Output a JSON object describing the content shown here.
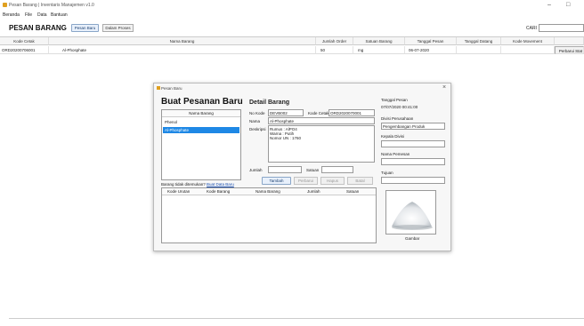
{
  "window": {
    "title": "Pesan Barang | Inventaris Manajemen v1.0",
    "min": "–",
    "max": "□"
  },
  "menu": [
    "Beranda",
    "File",
    "Data",
    "Bantuan"
  ],
  "page": {
    "title": "PESAN BARANG",
    "btn_pesan_baru": "Pesan Baru",
    "btn_dalam_proses": "Dalam Proses",
    "search_label": "CARI",
    "search_value": ""
  },
  "grid": {
    "columns": [
      "Kode Cetak",
      "Nama Barang",
      "Jumlah Order",
      "Satuan Barang",
      "Tanggal Pesan",
      "Tanggal Datang",
      "Kode Movement"
    ],
    "rows": [
      {
        "kode_cetak": "ORD20200706001",
        "nama_barang": "Al-Phosphate",
        "jumlah": "50",
        "satuan": "mg",
        "tanggal_pesan": "06-07-2020",
        "tanggal_datang": "",
        "kode_movement": "",
        "action": "Perbarui Stat"
      }
    ]
  },
  "dialog": {
    "title": "Pesan Baru",
    "close": "×",
    "heading": "Buat Pesanan Baru",
    "list_header": "Nama Barang",
    "list_items": [
      {
        "label": "Phenol",
        "selected": false
      },
      {
        "label": "Al-Phosphate",
        "selected": true
      }
    ],
    "not_found_text": "Barang tidak ditemukan?",
    "not_found_link": "Buat Data Baru",
    "detail": {
      "heading": "Detail Barang",
      "no_kode_label": "No Kode",
      "no_kode_value": "DEVB002",
      "kode_cetak_label": "Kode Cetak",
      "kode_cetak_value": "ORD2020070001",
      "nama_label": "Nama",
      "nama_value": "Al-Phosphate",
      "deskripsi_label": "Deskripsi",
      "deskripsi_lines": [
        "Rumus  : AlPO4",
        "Warna  : Putih",
        "Nomor UN : 1760"
      ],
      "jumlah_label": "Jumlah",
      "satuan_label": "Satuan",
      "btn_tambah": "Tambah",
      "btn_perbarui": "Perbarui",
      "btn_hapus": "Hapus",
      "btn_batal": "Batal"
    },
    "right": {
      "tanggal_label": "Tanggal Pesan",
      "tanggal_value": "07/07/2020 00:41:00",
      "divisi_label": "Divisi Perusahaan",
      "divisi_value": "Pengembangan Produk",
      "kepala_label": "Kepala Divisi",
      "nama_pemesan_label": "Nama Pemesan",
      "tujuan_label": "Tujuan",
      "gambar_label": "Gambar"
    },
    "table_columns": [
      "Kode Urutan",
      "Kode Barang",
      "Nama Barang",
      "Jumlah",
      "Satuan"
    ]
  },
  "colors": {
    "selection": "#1e88e5",
    "accent": "#1a3f70",
    "link": "#1a4fb0"
  }
}
